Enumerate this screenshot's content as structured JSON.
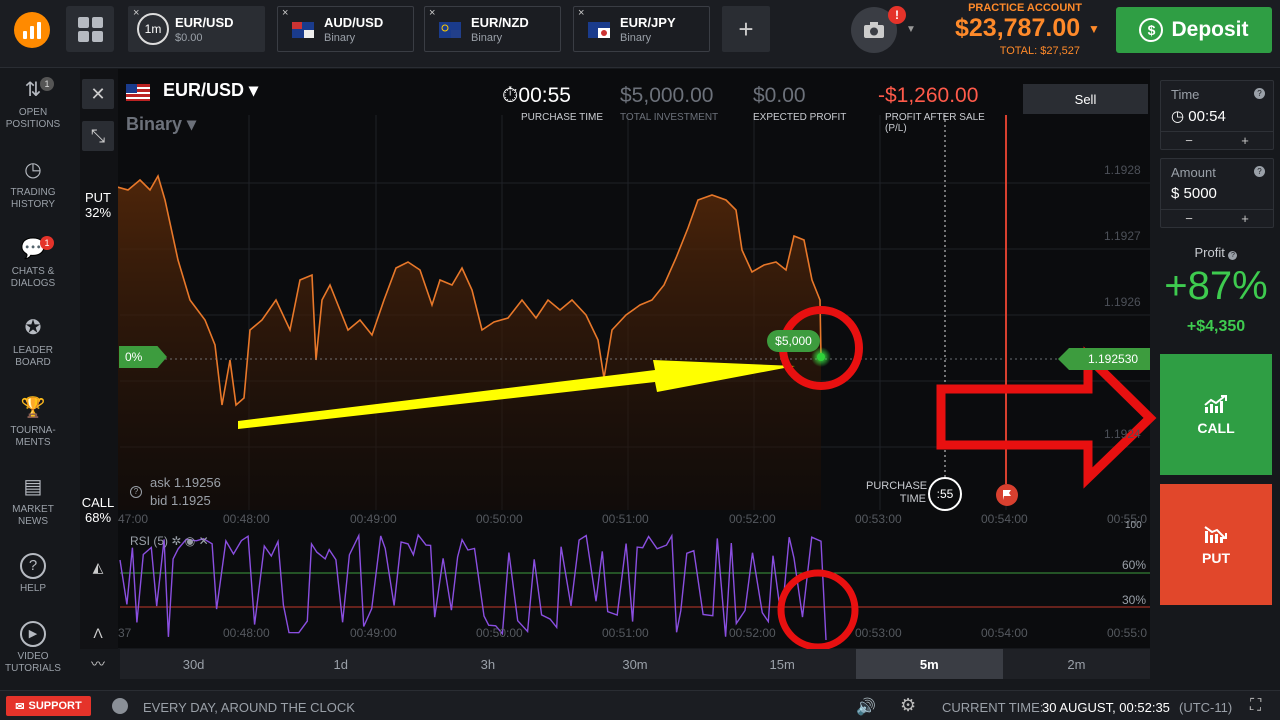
{
  "topbar": {
    "tabs": [
      {
        "name": "EUR/USD",
        "sub": "$0.00",
        "timer": "1m"
      },
      {
        "name": "AUD/USD",
        "sub": "Binary"
      },
      {
        "name": "EUR/NZD",
        "sub": "Binary"
      },
      {
        "name": "EUR/JPY",
        "sub": "Binary"
      }
    ],
    "close_glyph": "×",
    "add_glyph": "+",
    "camera_badge": "!",
    "account_label": "PRACTICE ACCOUNT",
    "balance": "$23,787.00",
    "total": "TOTAL: $27,527",
    "deposit_label": "Deposit",
    "deposit_icon_glyph": "$"
  },
  "sidebar": {
    "items": [
      {
        "label1": "OPEN",
        "label2": "POSITIONS",
        "badge": "1",
        "icon": "⇅"
      },
      {
        "label1": "TRADING",
        "label2": "HISTORY",
        "icon": "◷"
      },
      {
        "label1": "CHATS &",
        "label2": "DIALOGS",
        "badge": "1",
        "icon": "💬"
      },
      {
        "label1": "LEADER",
        "label2": "BOARD",
        "icon": "✪"
      },
      {
        "label1": "TOURNA-",
        "label2": "MENTS",
        "icon": "🏆"
      },
      {
        "label1": "MARKET",
        "label2": "NEWS",
        "icon": "▤"
      },
      {
        "label1": "HELP",
        "label2": "",
        "icon": "?"
      },
      {
        "label1": "VIDEO",
        "label2": "TUTORIALS",
        "icon": "▶"
      }
    ]
  },
  "chart": {
    "pair": "EUR/USD",
    "type": "Binary",
    "purchase_time": "00:55",
    "purchase_time_label": "PURCHASE TIME",
    "total_investment": "$5,000.00",
    "total_investment_label": "TOTAL INVESTMENT",
    "expected_profit": "$0.00",
    "expected_profit_label": "EXPECTED PROFIT",
    "profit_after_sale": "-$1,260.00",
    "profit_after_sale_label1": "PROFIT AFTER SALE",
    "profit_after_sale_label2": "(P/L)",
    "sell_label": "Sell",
    "put_label": "PUT",
    "put_pct": "32%",
    "call_label": "CALL",
    "call_pct": "68%",
    "zero_pct": "0%",
    "current_price": "1.192530",
    "investment_tag": "$5,000",
    "ask": "ask 1.19256",
    "bid": "bid 1.1925",
    "purchase_label1": "PURCHASE",
    "purchase_label2": "TIME",
    "countdown": ":55",
    "y_ticks": [
      "1.1928",
      "1.1927",
      "1.1926",
      "1.1924"
    ],
    "x_ticks": [
      "00:48:00",
      "00:49:00",
      "00:50:00",
      "00:51:00",
      "00:52:00",
      "00:53:00",
      "00:54:00"
    ],
    "x_ticks_rsi": [
      "00:48:00",
      "00:49:00",
      "00:50:00",
      "00:51:00",
      "00:52:00",
      "00:53:00",
      "00:54:00"
    ],
    "x_edge_left": "47:00",
    "x_edge_right": "00:55:0",
    "x_edge_left_rsi": "37",
    "x_edge_right_rsi": "00:55:0"
  },
  "rsi": {
    "title": "RSI (5)",
    "level_high": "60%",
    "level_low": "30%",
    "level_top": "100"
  },
  "periods": [
    "30d",
    "1d",
    "3h",
    "30m",
    "15m",
    "5m",
    "2m"
  ],
  "active_period": "5m",
  "right": {
    "time_label": "Time",
    "time_value": "00:54",
    "amount_label": "Amount",
    "amount_value": "$ 5000",
    "minus": "−",
    "plus": "+",
    "help_glyph": "?",
    "profit_label": "Profit",
    "profit_pct": "+87%",
    "profit_amount": "+$4,350",
    "call_label": "CALL",
    "put_label": "PUT"
  },
  "bottom": {
    "support": "SUPPORT",
    "everyday": "EVERY DAY, AROUND THE CLOCK",
    "current_time_label": "CURRENT TIME:",
    "current_time": "30 AUGUST, 00:52:35",
    "timezone": "(UTC-11)"
  },
  "colors": {
    "accent_orange": "#ff8a2a",
    "call_green": "#2f9e44",
    "put_red": "#e1472b",
    "price_line": "#e8782a",
    "rsi_line": "#8a4fe0",
    "annotation_red": "#e81010",
    "annotation_yellow": "#ffff00"
  }
}
